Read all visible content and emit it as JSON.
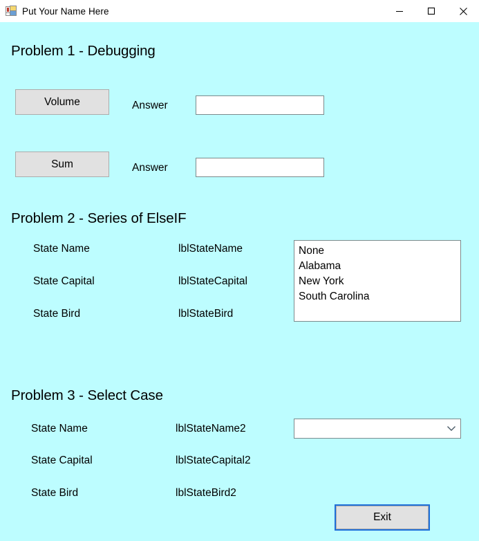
{
  "window": {
    "title": "Put Your Name Here",
    "icon": "vb-form-icon",
    "background_color": "#BDFDFF",
    "controls": [
      {
        "name": "minimize",
        "icon": "minimize-icon"
      },
      {
        "name": "maximize",
        "icon": "maximize-icon"
      },
      {
        "name": "close",
        "icon": "close-icon"
      }
    ]
  },
  "problem1": {
    "heading": "Problem 1 - Debugging",
    "rows": [
      {
        "button_label": "Volume",
        "answer_label": "Answer",
        "textbox_value": "",
        "textbox_placeholder": ""
      },
      {
        "button_label": "Sum",
        "answer_label": "Answer",
        "textbox_value": "",
        "textbox_placeholder": ""
      }
    ]
  },
  "problem2": {
    "heading": "Problem 2 - Series of ElseIF",
    "rows": [
      {
        "caption": "State Name",
        "value_label": "lblStateName"
      },
      {
        "caption": "State Capital",
        "value_label": "lblStateCapital"
      },
      {
        "caption": "State Bird",
        "value_label": "lblStateBird"
      }
    ],
    "listbox": {
      "items": [
        "None",
        "Alabama",
        "New York",
        "South Carolina"
      ],
      "selected": ""
    }
  },
  "problem3": {
    "heading": "Problem 3 - Select Case",
    "rows": [
      {
        "caption": "State Name",
        "value_label": "lblStateName2"
      },
      {
        "caption": "State Capital",
        "value_label": "lblStateCapital2"
      },
      {
        "caption": "State Bird",
        "value_label": "lblStateBird2"
      }
    ],
    "combobox": {
      "selected": "",
      "placeholder": "",
      "arrow_icon": "chevron-down-icon"
    }
  },
  "footer": {
    "exit_label": "Exit",
    "focus_color": "#1E6FD9"
  }
}
